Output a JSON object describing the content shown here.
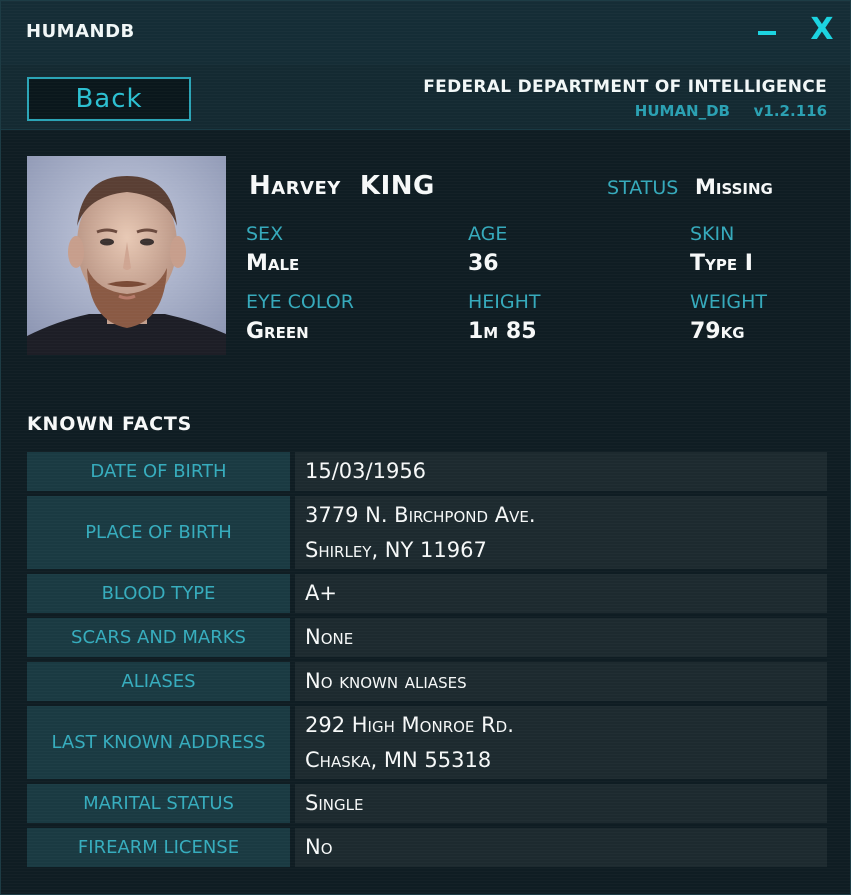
{
  "window": {
    "title": "HUMANDB",
    "minimize_icon": "minimize-icon",
    "close_icon": "close-icon",
    "close_glyph": "X"
  },
  "header": {
    "back_label": "Back",
    "agency": "FEDERAL DEPARTMENT OF INTELLIGENCE",
    "db_name": "HUMAN_DB",
    "version": "v1.2.116"
  },
  "profile": {
    "first_name": "Harvey",
    "last_name": "KING",
    "status_label": "STATUS",
    "status_value": "Missing",
    "sex_label": "SEX",
    "sex_value": "Male",
    "age_label": "AGE",
    "age_value": "36",
    "skin_label": "SKIN",
    "skin_value": "Type I",
    "eye_label": "EYE COLOR",
    "eye_value": "Green",
    "height_label": "HEIGHT",
    "height_value": "1m 85",
    "weight_label": "WEIGHT",
    "weight_value": "79kg"
  },
  "facts": {
    "heading": "KNOWN FACTS",
    "rows": [
      {
        "label": "DATE OF BIRTH",
        "lines": [
          "15/03/1956"
        ]
      },
      {
        "label": "PLACE OF BIRTH",
        "lines": [
          "3779 N. Birchpond Ave.",
          "Shirley, NY 11967"
        ]
      },
      {
        "label": "BLOOD TYPE",
        "lines": [
          "A+"
        ]
      },
      {
        "label": "SCARS AND MARKS",
        "lines": [
          "None"
        ]
      },
      {
        "label": "ALIASES",
        "lines": [
          "No known aliases"
        ]
      },
      {
        "label": "LAST KNOWN ADDRESS",
        "lines": [
          "292 High Monroe Rd.",
          "Chaska, MN 55318"
        ]
      },
      {
        "label": "MARITAL STATUS",
        "lines": [
          "Single"
        ]
      },
      {
        "label": "FIREARM LICENSE",
        "lines": [
          "No"
        ]
      }
    ]
  },
  "colors": {
    "accent": "#1bd3e0",
    "label": "#35a9bb",
    "text": "#f6f8f8",
    "background": "#0f1d23"
  }
}
